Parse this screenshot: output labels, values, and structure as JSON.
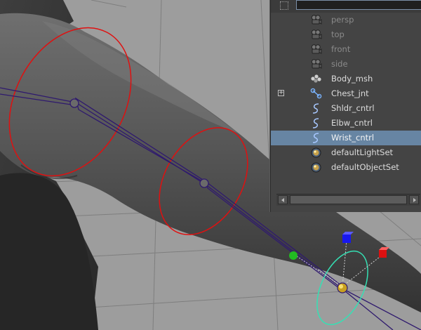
{
  "outliner": {
    "items": [
      {
        "label": "persp",
        "icon": "camera-icon",
        "state": "dim",
        "expandable": false
      },
      {
        "label": "top",
        "icon": "camera-icon",
        "state": "dim",
        "expandable": false
      },
      {
        "label": "front",
        "icon": "camera-icon",
        "state": "dim",
        "expandable": false
      },
      {
        "label": "side",
        "icon": "camera-icon",
        "state": "dim",
        "expandable": false
      },
      {
        "label": "Body_msh",
        "icon": "mesh-icon",
        "state": "normal",
        "expandable": false
      },
      {
        "label": "Chest_jnt",
        "icon": "joint-icon",
        "state": "normal",
        "expandable": true
      },
      {
        "label": "Shldr_cntrl",
        "icon": "curve-icon",
        "state": "normal",
        "expandable": false
      },
      {
        "label": "Elbw_cntrl",
        "icon": "curve-icon",
        "state": "normal",
        "expandable": false
      },
      {
        "label": "Wrist_cntrl",
        "icon": "curve-icon",
        "state": "selected",
        "expandable": false
      },
      {
        "label": "defaultLightSet",
        "icon": "set-icon",
        "state": "normal",
        "expandable": false
      },
      {
        "label": "defaultObjectSet",
        "icon": "set-icon",
        "state": "normal",
        "expandable": false
      }
    ],
    "expand_symbol": "+"
  },
  "colors": {
    "viewport_bg": "#9d9d9d",
    "grid": "#7c7c7c",
    "control_curve": "#e01010",
    "skeleton": "#2f1a6e",
    "selected_row": "#6785a3",
    "wrist_control": "#35e0b4",
    "gizmo_x": "#dd1111",
    "gizmo_y": "#22bb22",
    "gizmo_z": "#1818ee"
  }
}
